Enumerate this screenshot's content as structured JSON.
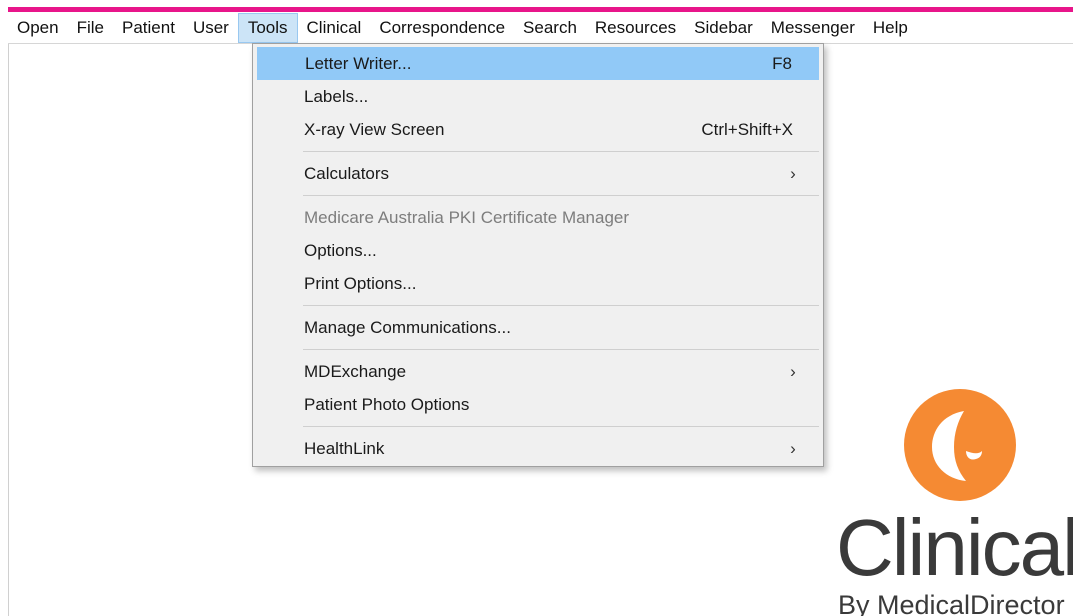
{
  "menubar": {
    "items": [
      {
        "label": "Open"
      },
      {
        "label": "File"
      },
      {
        "label": "Patient"
      },
      {
        "label": "User"
      },
      {
        "label": "Tools"
      },
      {
        "label": "Clinical"
      },
      {
        "label": "Correspondence"
      },
      {
        "label": "Search"
      },
      {
        "label": "Resources"
      },
      {
        "label": "Sidebar"
      },
      {
        "label": "Messenger"
      },
      {
        "label": "Help"
      }
    ],
    "active": "Tools"
  },
  "tools_menu": {
    "items": [
      {
        "label": "Letter Writer...",
        "shortcut": "F8"
      },
      {
        "label": "Labels..."
      },
      {
        "label": "X-ray View Screen",
        "shortcut": "Ctrl+Shift+X"
      },
      {
        "label": "Calculators",
        "submenu": true
      },
      {
        "label": "Medicare Australia PKI Certificate Manager",
        "disabled": true
      },
      {
        "label": "Options..."
      },
      {
        "label": "Print Options..."
      },
      {
        "label": "Manage Communications..."
      },
      {
        "label": "MDExchange",
        "submenu": true
      },
      {
        "label": "Patient Photo Options"
      },
      {
        "label": "HealthLink",
        "submenu": true
      }
    ],
    "highlighted": "Letter Writer...",
    "submenu_glyph": "›"
  },
  "branding": {
    "name": "Clinical",
    "byline": "By MedicalDirector",
    "colors": {
      "accent_bar": "#e8158a",
      "logo_orange": "#f58a33",
      "highlight": "#91c9f7"
    }
  }
}
